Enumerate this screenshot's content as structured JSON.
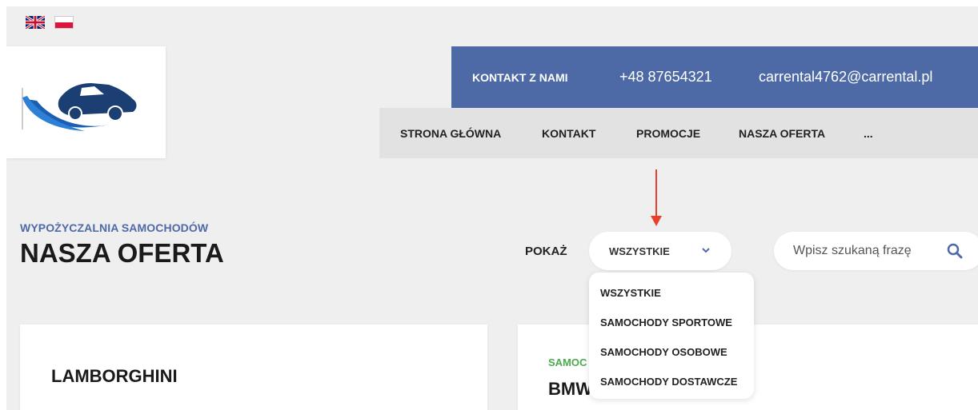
{
  "languages": [
    {
      "code": "en",
      "icon": "uk-flag-icon"
    },
    {
      "code": "pl",
      "icon": "poland-flag-icon"
    }
  ],
  "contact": {
    "label": "KONTAKT Z NAMI",
    "phone": "+48 87654321",
    "email": "carrental4762@carrental.pl"
  },
  "nav": {
    "items": [
      "STRONA GŁÓWNA",
      "KONTAKT",
      "PROMOCJE",
      "NASZA OFERTA",
      "..."
    ]
  },
  "page": {
    "subtitle": "WYPOŻYCZALNIA SAMOCHODÓW",
    "title": "NASZA OFERTA"
  },
  "filter": {
    "label": "POKAŻ",
    "selected": "WSZYSTKIE",
    "options": [
      "WSZYSTKIE",
      "SAMOCHODY SPORTOWE",
      "SAMOCHODY OSOBOWE",
      "SAMOCHODY DOSTAWCZE"
    ]
  },
  "search": {
    "placeholder": "Wpisz szukaną frazę"
  },
  "cards": [
    {
      "title": "LAMBORGHINI"
    },
    {
      "category": "SAMOC",
      "title": "BMW"
    }
  ],
  "colors": {
    "brand": "#4e6aa6",
    "category_green": "#4caa4e",
    "arrow_red": "#e8402a",
    "background": "#efefef"
  }
}
